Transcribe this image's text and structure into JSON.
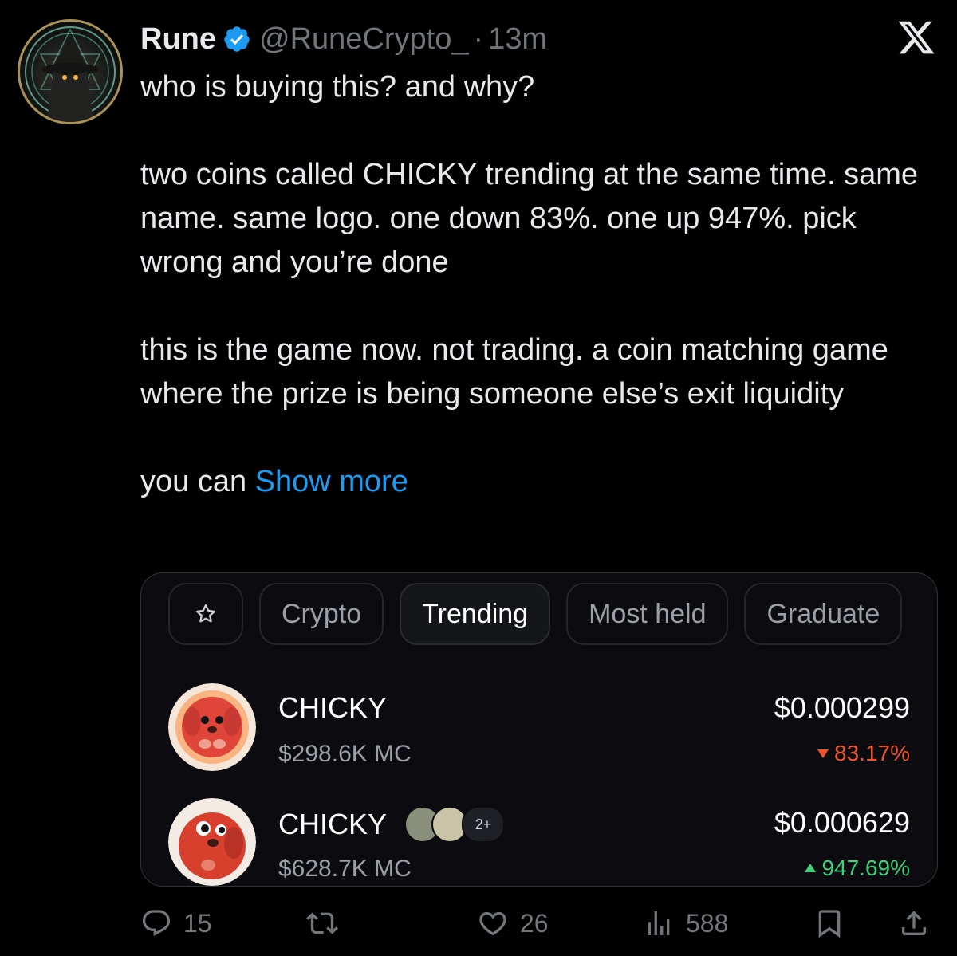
{
  "author": {
    "name": "Rune",
    "handle": "@RuneCrypto_",
    "separator": "·",
    "time": "13m"
  },
  "tweet": {
    "p1": "who is buying this? and why?",
    "p2": "two coins called CHICKY trending at the same time. same name. same logo. one down 83%. one up 947%. pick wrong and you’re done",
    "p3": "this is the game now. not trading. a coin matching game where the prize is being someone else’s exit liquidity",
    "p4": "you can",
    "show_more": "Show more"
  },
  "card": {
    "tabs": [
      {
        "label": "Crypto"
      },
      {
        "label": "Trending",
        "active": true
      },
      {
        "label": "Most held"
      },
      {
        "label": "Graduate"
      }
    ],
    "coins": [
      {
        "name": "CHICKY",
        "mc": "$298.6K MC",
        "price": "$0.000299",
        "change": "83.17%",
        "direction": "down"
      },
      {
        "name": "CHICKY",
        "mc": "$628.7K MC",
        "price": "$0.000629",
        "change": "947.69%",
        "direction": "up",
        "holders_more": "2+"
      }
    ]
  },
  "actions": {
    "replies": "15",
    "likes": "26",
    "views": "588"
  },
  "icons": [
    "verified-badge-icon",
    "x-logo-icon",
    "star-icon",
    "reply-icon",
    "retweet-icon",
    "like-icon",
    "views-icon",
    "bookmark-icon",
    "share-icon"
  ],
  "colors": {
    "background": "#000000",
    "text": "#e7e9ea",
    "muted": "#71767b",
    "link": "#1d9bf0",
    "down": "#f0542d",
    "up": "#3fd17a"
  }
}
